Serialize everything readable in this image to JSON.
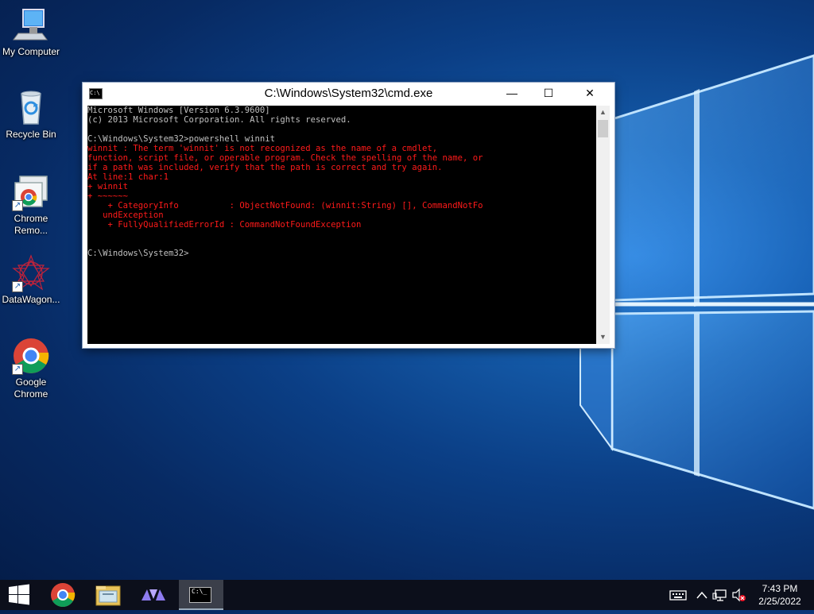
{
  "desktop": {
    "icons": [
      {
        "label": "My Computer"
      },
      {
        "label": "Recycle Bin"
      },
      {
        "label": "Chrome\nRemo..."
      },
      {
        "label": "DataWagon..."
      },
      {
        "label": "Google\nChrome"
      }
    ]
  },
  "cmd_window": {
    "title": "C:\\Windows\\System32\\cmd.exe",
    "title_icon_text": "C:\\",
    "minimize_glyph": "—",
    "maximize_glyph": "☐",
    "close_glyph": "✕",
    "lines": [
      {
        "text": "Microsoft Windows [Version 6.3.9600]",
        "color": "white"
      },
      {
        "text": "(c) 2013 Microsoft Corporation. All rights reserved.",
        "color": "white"
      },
      {
        "text": "",
        "color": "white"
      },
      {
        "text": "C:\\Windows\\System32>powershell winnit",
        "color": "white"
      },
      {
        "text": "winnit : The term 'winnit' is not recognized as the name of a cmdlet,",
        "color": "red"
      },
      {
        "text": "function, script file, or operable program. Check the spelling of the name, or",
        "color": "red"
      },
      {
        "text": "if a path was included, verify that the path is correct and try again.",
        "color": "red"
      },
      {
        "text": "At line:1 char:1",
        "color": "red"
      },
      {
        "text": "+ winnit",
        "color": "red"
      },
      {
        "text": "+ ~~~~~~",
        "color": "red"
      },
      {
        "text": "    + CategoryInfo          : ObjectNotFound: (winnit:String) [], CommandNotFo",
        "color": "red"
      },
      {
        "text": "   undException",
        "color": "red"
      },
      {
        "text": "    + FullyQualifiedErrorId : CommandNotFoundException",
        "color": "red"
      },
      {
        "text": "",
        "color": "white"
      },
      {
        "text": "",
        "color": "white"
      },
      {
        "text": "C:\\Windows\\System32>",
        "color": "white"
      }
    ]
  },
  "taskbar": {
    "clock_time": "7:43 PM",
    "clock_date": "2/25/2022",
    "cmd_button_text": "C:\\_"
  },
  "colors": {
    "console_bg": "#000000",
    "console_text": "#c0c0c0",
    "error_text": "#ff1a1a",
    "taskbar_bg": "#0c0f1b"
  }
}
